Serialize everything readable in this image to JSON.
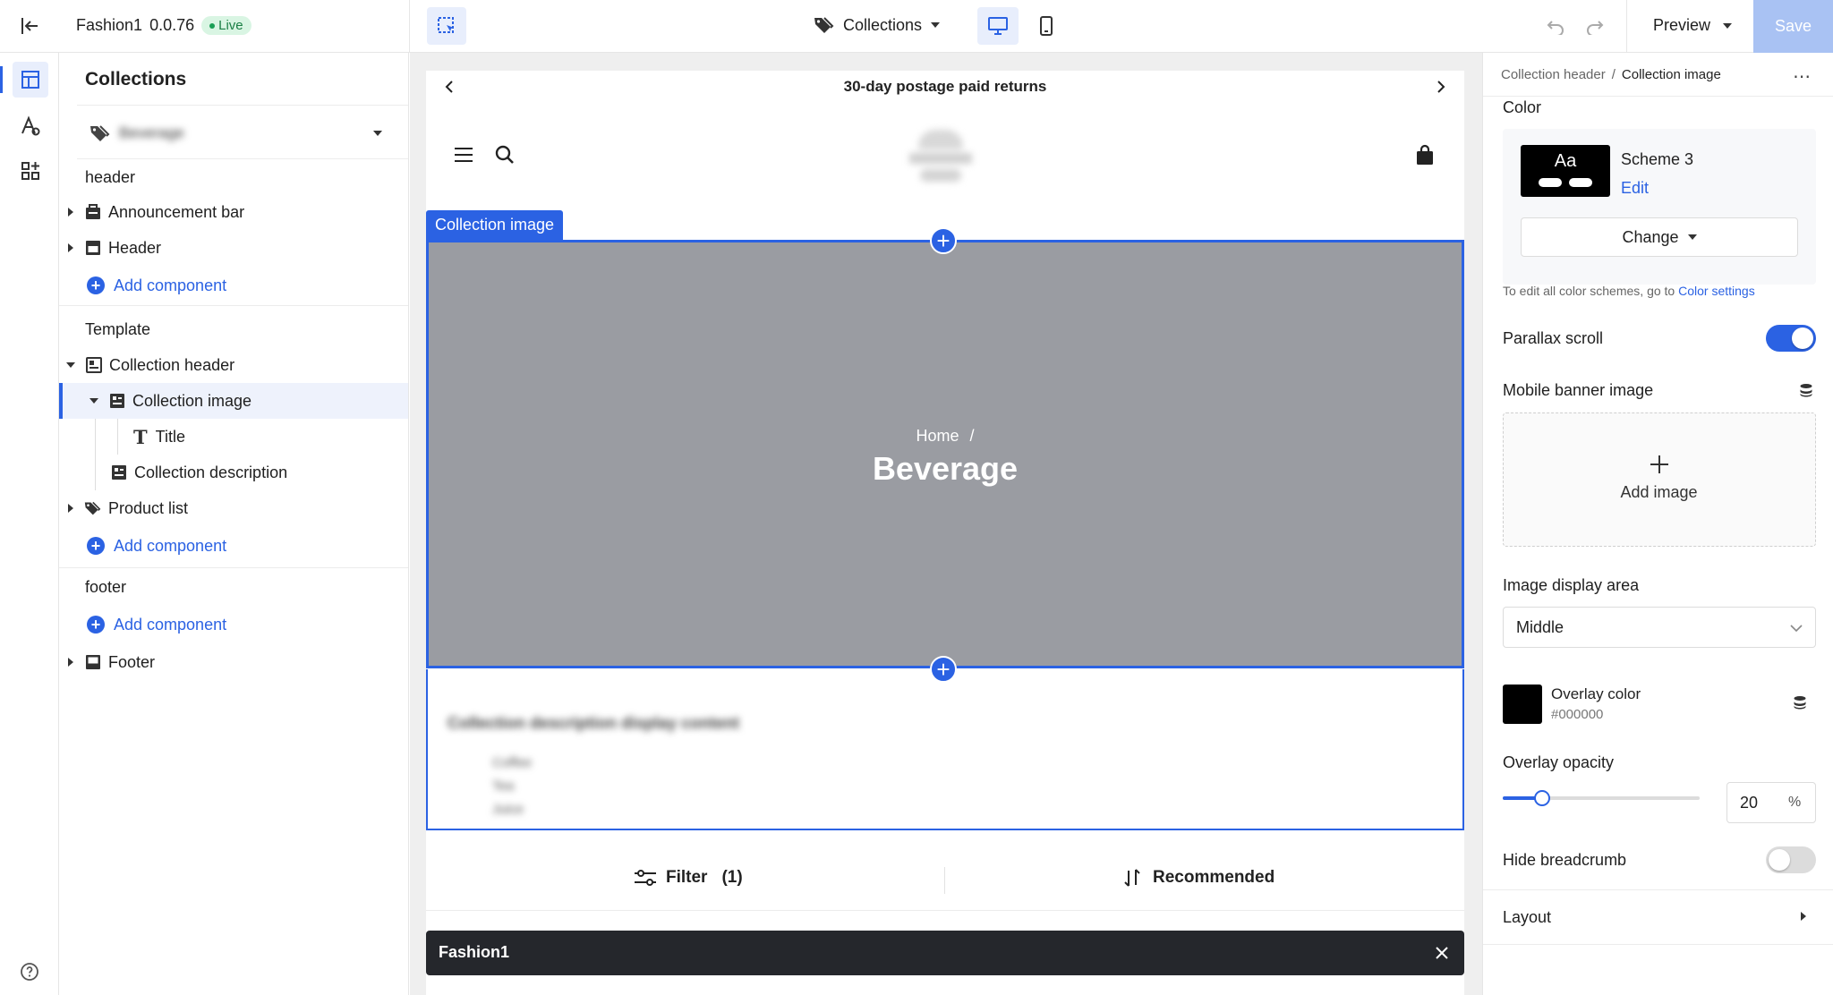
{
  "topbar": {
    "theme_name": "Fashion1",
    "version": "0.0.76",
    "status_badge": "Live",
    "page_selector_label": "Collections",
    "preview_label": "Preview",
    "save_label": "Save"
  },
  "tree": {
    "title": "Collections",
    "collection_selector_value": "Beverage",
    "groups": {
      "header_label": "header",
      "template_label": "Template",
      "footer_label": "footer"
    },
    "items": {
      "announcement_bar": "Announcement bar",
      "header": "Header",
      "add_component": "Add component",
      "collection_header": "Collection header",
      "collection_image": "Collection image",
      "title": "Title",
      "collection_description": "Collection description",
      "product_list": "Product list",
      "footer": "Footer"
    }
  },
  "canvas": {
    "announcement": "30-day postage paid returns",
    "selection_label": "Collection image",
    "breadcrumb_home": "Home",
    "breadcrumb_sep": "/",
    "collection_title": "Beverage",
    "description_title": "Collection description display content",
    "description_items": [
      "Coffee",
      "Tea",
      "Juice"
    ],
    "filter_label": "Filter",
    "filter_count": "(1)",
    "sort_label": "Recommended",
    "bottom_bar_label": "Fashion1"
  },
  "panel": {
    "breadcrumb_parent": "Collection header",
    "breadcrumb_sep": "/",
    "breadcrumb_current": "Collection image",
    "color_label": "Color",
    "scheme_preview": "Aa",
    "scheme_name": "Scheme 3",
    "scheme_edit": "Edit",
    "change_label": "Change",
    "color_hint": "To edit all color schemes, go to",
    "color_hint_link": "Color settings",
    "parallax_label": "Parallax scroll",
    "parallax_on": true,
    "mobile_banner_label": "Mobile banner image",
    "add_image_label": "Add image",
    "display_area_label": "Image display area",
    "display_area_value": "Middle",
    "overlay_color_label": "Overlay color",
    "overlay_color_value": "#000000",
    "overlay_opacity_label": "Overlay opacity",
    "overlay_opacity_value": "20",
    "overlay_opacity_unit": "%",
    "hide_breadcrumb_label": "Hide breadcrumb",
    "hide_breadcrumb_on": false,
    "layout_label": "Layout"
  },
  "colors": {
    "accent": "#2b62e3",
    "live_badge_bg": "#d9f5e3",
    "live_badge_text": "#1a7f45",
    "image_placeholder": "#9a9ca2",
    "toggle_on": "#2b62e3",
    "toggle_off": "#dcdcdc",
    "save_bg": "#a9c2f3"
  }
}
